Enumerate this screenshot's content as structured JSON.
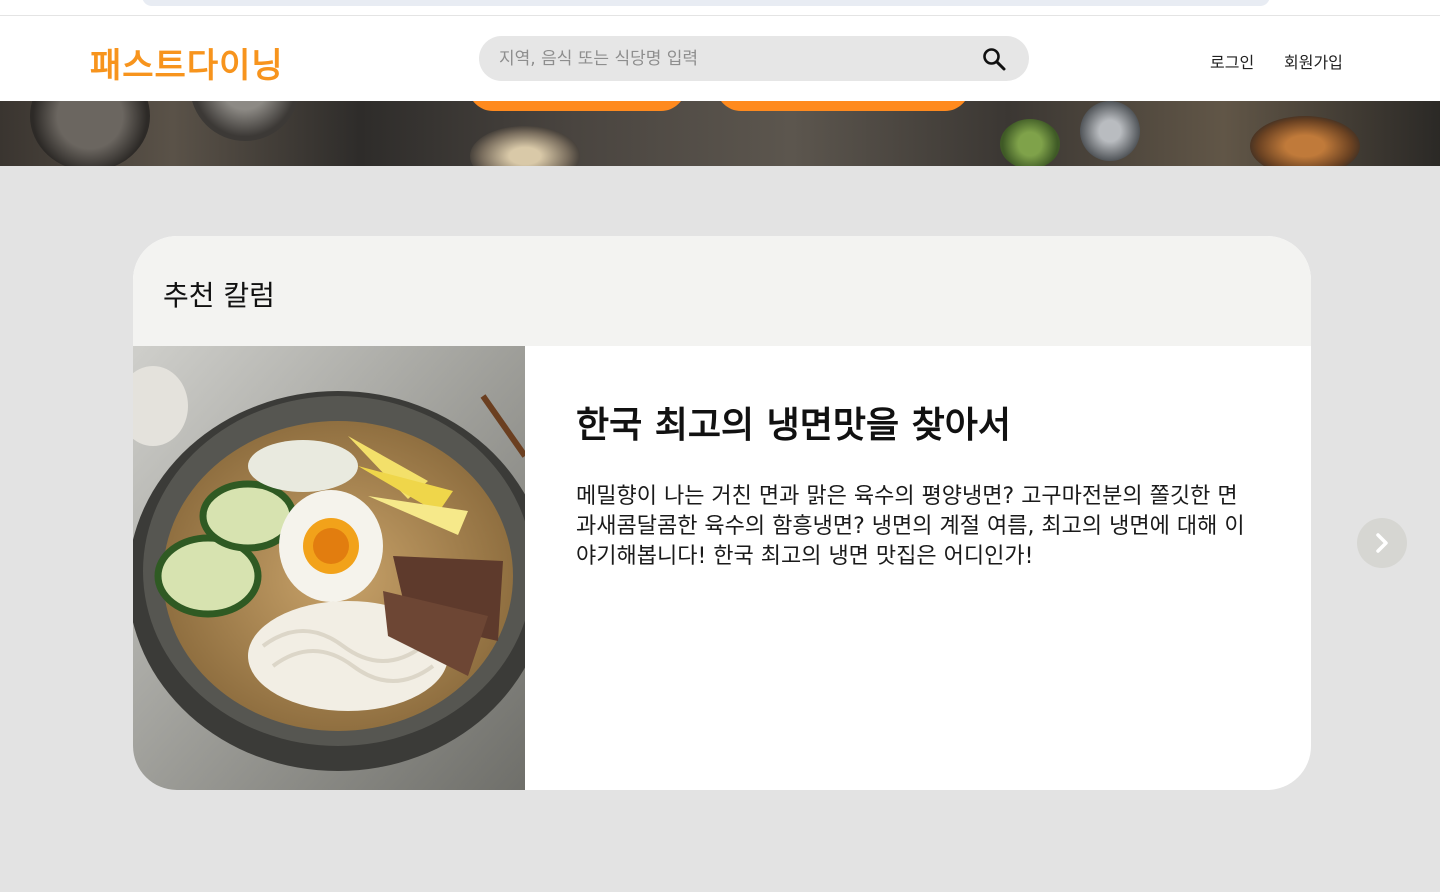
{
  "brand": {
    "name": "패스트다이닝",
    "color": "#f7941d"
  },
  "search": {
    "placeholder": "지역, 음식 또는 식당명 입력",
    "value": "",
    "icon": "search-icon"
  },
  "nav": {
    "login": "로그인",
    "signup": "회원가입"
  },
  "hero": {
    "accent": "#ff8a1e"
  },
  "column_section": {
    "heading": "추천 칼럼",
    "article": {
      "title": "한국 최고의 냉면맛을 찾아서",
      "body": "메밀향이 나는 거친 면과 맑은 육수의 평양냉면? 고구마전분의 쫄깃한 면과새콤달콤한 육수의 함흥냉면? 냉면의 계절 여름, 최고의 냉면에 대해 이야기해봅니다! 한국 최고의 냉면 맛집은 어디인가!",
      "image": "naengmyeon-bowl-photo"
    },
    "next_icon": "chevron-right-icon"
  }
}
